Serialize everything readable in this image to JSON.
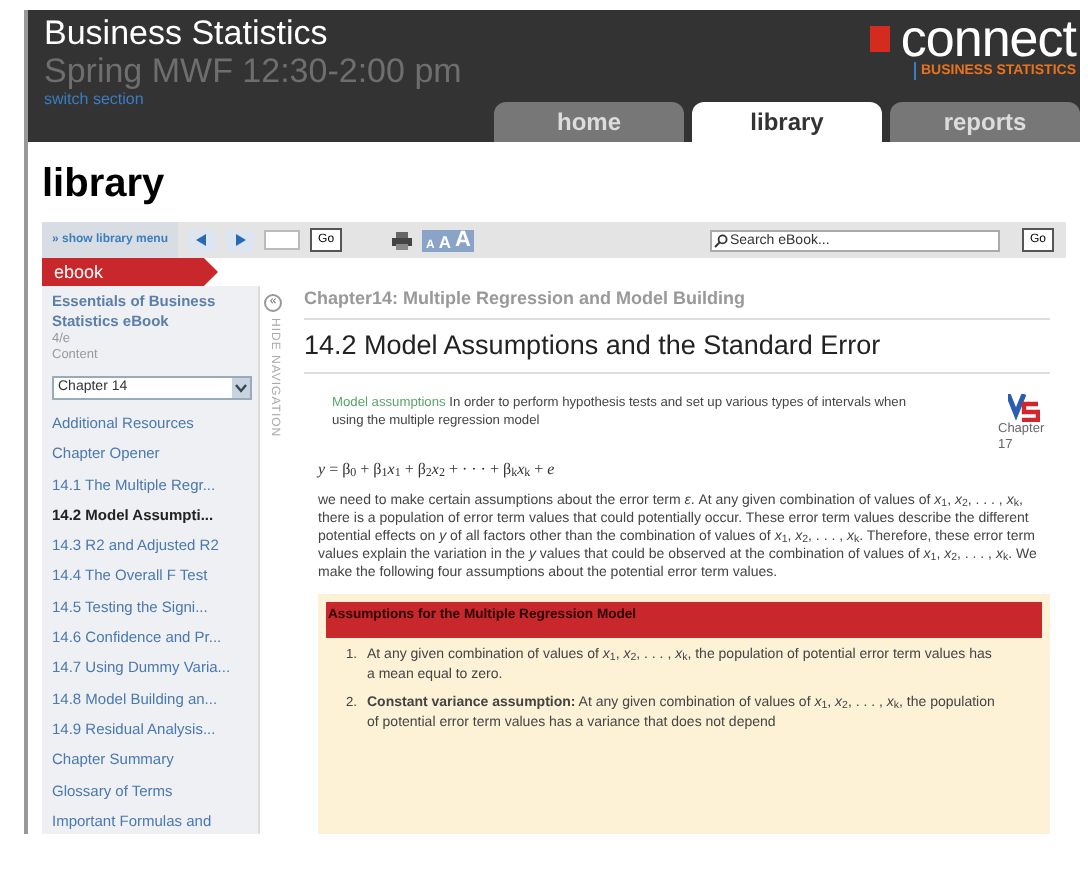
{
  "header": {
    "title": "Business Statistics",
    "section": "Spring MWF 12:30-2:00 pm",
    "switch_link": "switch section",
    "logo_brand": "connect",
    "logo_product": "BUSINESS STATISTICS"
  },
  "tabs": [
    {
      "label": "home",
      "selected": false
    },
    {
      "label": "library",
      "selected": true
    },
    {
      "label": "reports",
      "selected": false
    }
  ],
  "page_title": "library",
  "toolbar": {
    "library_menu": "» show library menu",
    "page_go": "Go",
    "font_sizes": [
      "A",
      "A",
      "A"
    ],
    "search_placeholder": "Search eBook...",
    "search_go": "Go"
  },
  "sidebar": {
    "tab": "ebook",
    "book_title": "Essentials of Business Statistics eBook",
    "edition": "4/e",
    "content_label": "Content",
    "chapter_select": "Chapter 14",
    "collapse": "«",
    "hide_nav": "HIDE NAVIGATION",
    "items": [
      {
        "label": "Additional Resources",
        "selected": false
      },
      {
        "label": "Chapter Opener",
        "selected": false
      },
      {
        "label": "14.1 The Multiple Regr...",
        "selected": false
      },
      {
        "label": "14.2 Model Assumpti...",
        "selected": true
      },
      {
        "label": "14.3 R2 and Adjusted R2",
        "selected": false
      },
      {
        "label": "14.4 The Overall F Test",
        "selected": false
      },
      {
        "label": "14.5 Testing the Signi...",
        "selected": false
      },
      {
        "label": "14.6 Confidence and Pr...",
        "selected": false
      },
      {
        "label": "14.7 Using Dummy Varia...",
        "selected": false
      },
      {
        "label": "14.8 Model Building an...",
        "selected": false
      },
      {
        "label": "14.9 Residual Analysis...",
        "selected": false
      },
      {
        "label": "Chapter Summary",
        "selected": false
      },
      {
        "label": "Glossary of Terms",
        "selected": false
      },
      {
        "label": "Important Formulas and",
        "selected": false
      }
    ]
  },
  "content": {
    "chapter": "Chapter14: Multiple Regression and Model Building",
    "heading": "14.2 Model Assumptions and the Standard Error",
    "intro_link": "Model assumptions",
    "intro": "In order to perform hypothesis tests and set up various types of intervals when using the multiple regression model",
    "video_label": "Chapter 17",
    "equation": "*y* = β$_{0}$ + β$_{1}$*x*$_{1}$ + β$_{2}$*x*$_{2}$ + · · · + β$_{k}$*x*$_{k}$ + *e*",
    "paragraph": "we need to make certain assumptions about the error term *ε*. At any given combination of values of *x*$_{1}$, *x*$_{2}$, . . . , *x*$_{k}$, there is a population of error term values that could potentially occur. These error term values describe the different potential effects on *y* of all factors other than the combination of values of *x*$_{1}$, *x*$_{2}$, . . . , *x*$_{k}$. Therefore, these error term values explain the variation in the *y* values that could be observed at the combination of values of *x*$_{1}$, *x*$_{2}$, . . . , *x*$_{k}$. We make the following four assumptions about the potential error term values.",
    "box_title": "Assumptions for the Multiple Regression Model",
    "assumptions": [
      {
        "number": "1.",
        "text": "At any given combination of values of *x*$_{1}$, *x*$_{2}$, . . . , *x*$_{k}$, the population of potential error term values has a mean equal to zero."
      },
      {
        "number": "2.",
        "text": "**Constant variance assumption:** At any given combination of values of *x*$_{1}$, *x*$_{2}$, . . . , *x*$_{k}$, the population of potential error term values has a variance that does not depend"
      }
    ]
  }
}
